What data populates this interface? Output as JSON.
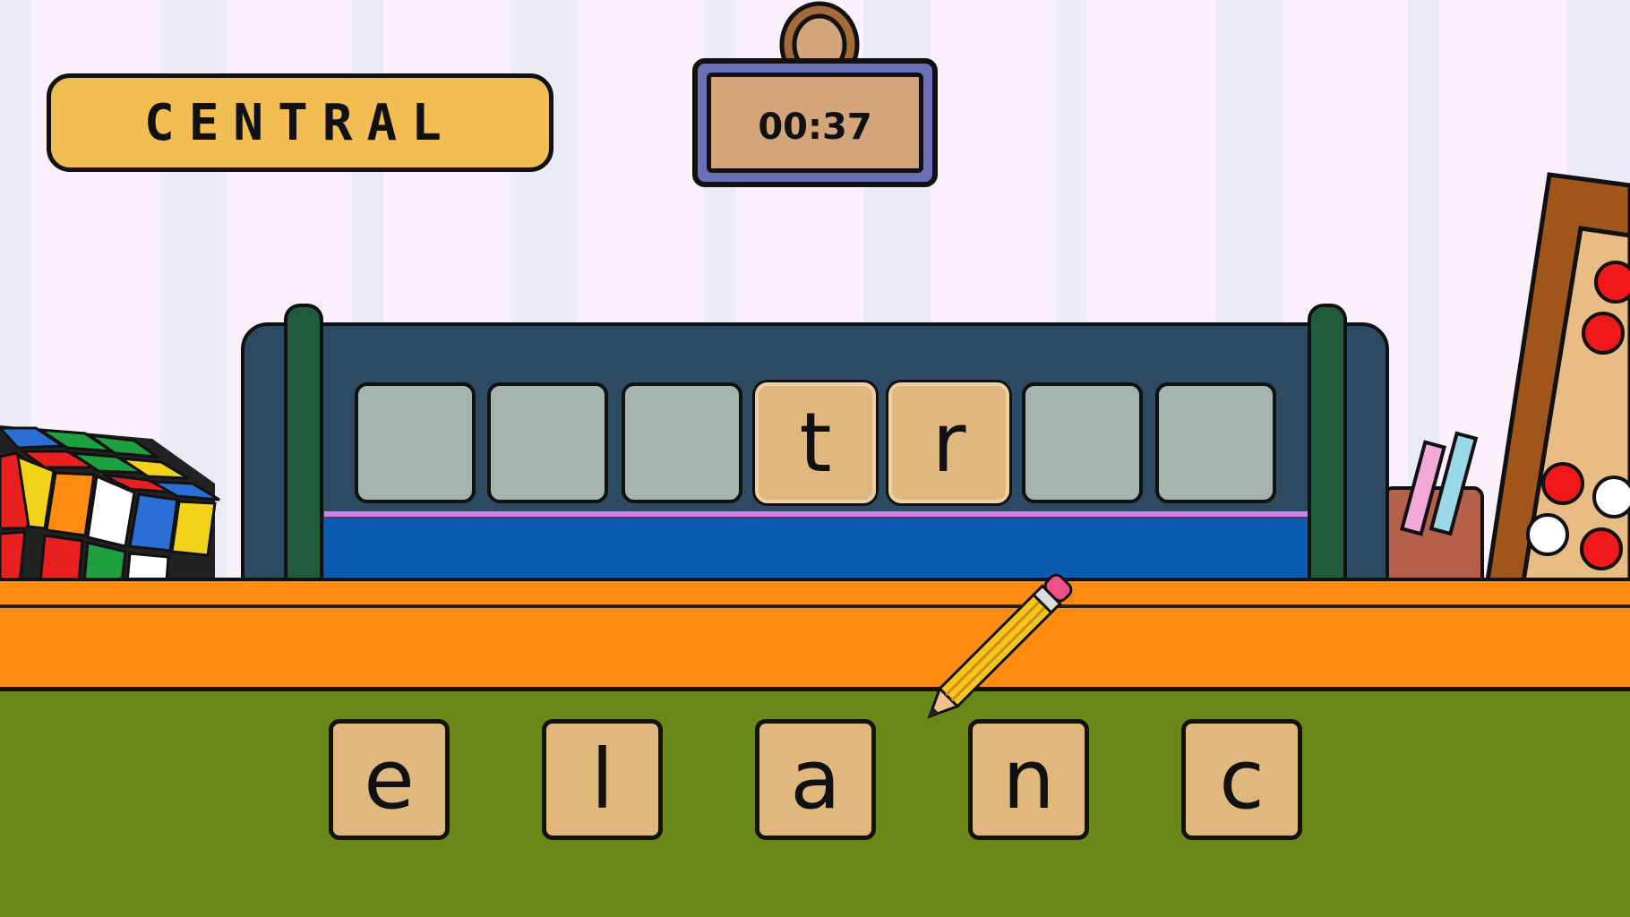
{
  "category": "CENTRAL",
  "timer": "00:37",
  "answer_slots": [
    "",
    "",
    "",
    "t",
    "r",
    "",
    ""
  ],
  "letter_tiles": [
    "e",
    "l",
    "a",
    "n",
    "c"
  ],
  "colors": {
    "category_bg": "#f2bd52",
    "timer_frame": "#6a6fb8",
    "tray": "#2d4a63",
    "tile": "#e0b87d",
    "empty_slot": "#a5b5ae",
    "shelf": "#ff8c10",
    "floor": "#6a8718"
  }
}
